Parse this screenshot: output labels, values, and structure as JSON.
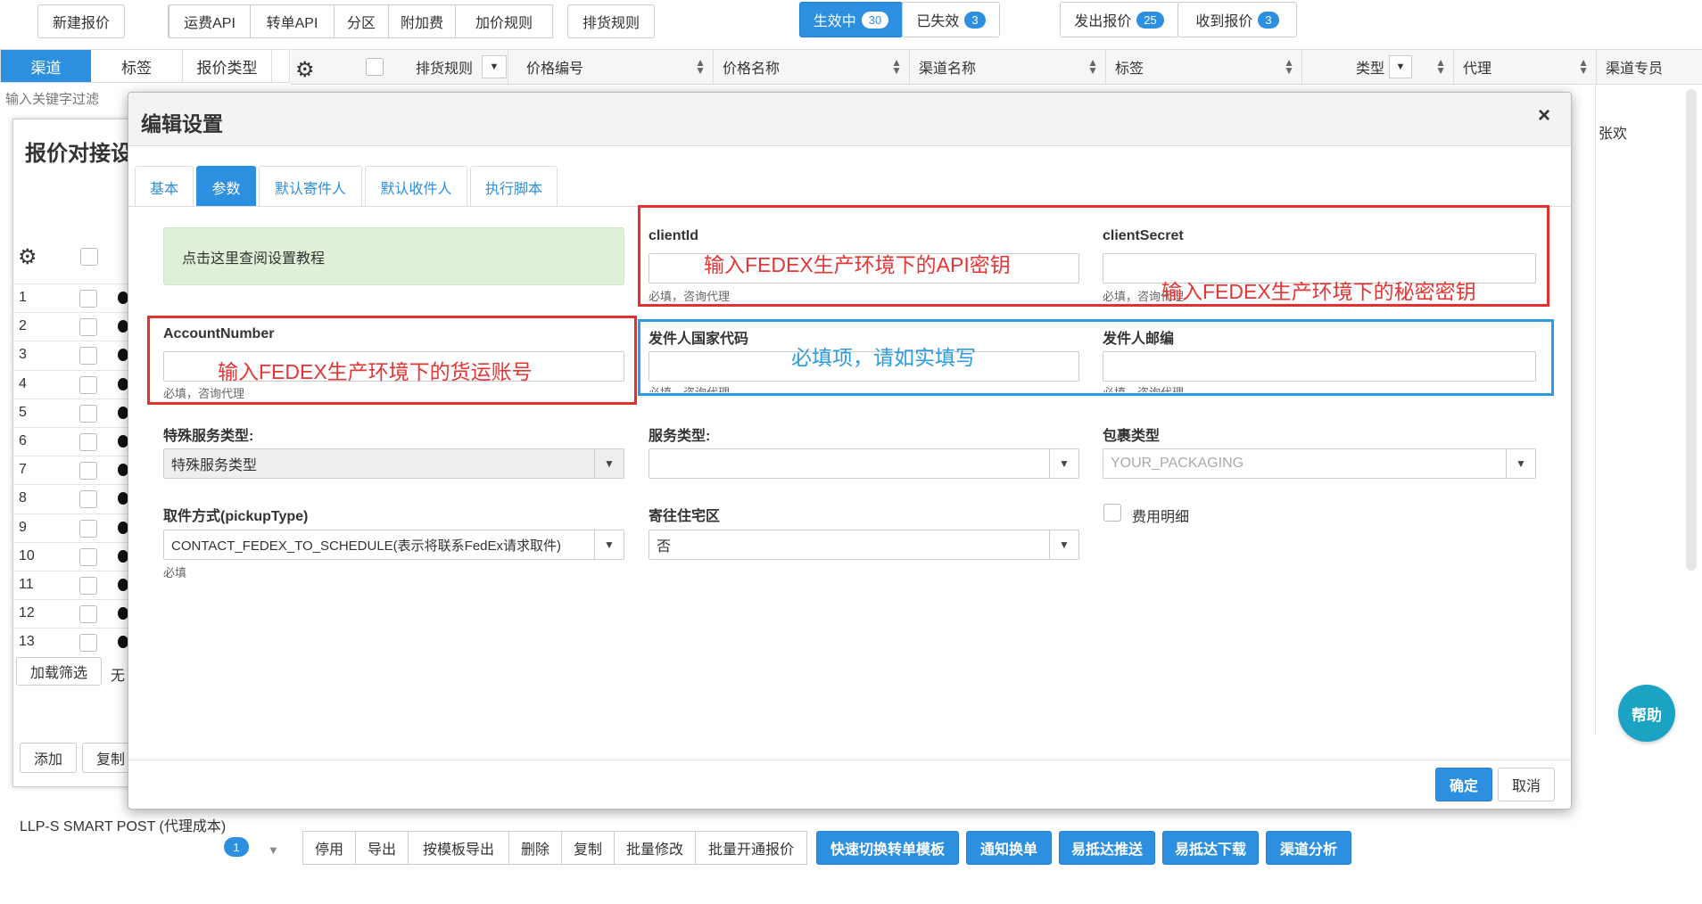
{
  "toolbar": {
    "new_quote": "新建报价",
    "group1": [
      "运费API",
      "转单API",
      "分区",
      "附加费",
      "加价规则"
    ],
    "shipping_rules": "排货规则",
    "status_active_label": "生效中",
    "status_active_count": "30",
    "status_expired_label": "已失效",
    "status_expired_count": "3",
    "sent_quotes_label": "发出报价",
    "sent_quotes_count": "25",
    "received_quotes_label": "收到报价",
    "received_quotes_count": "3"
  },
  "left_panel": {
    "tabs": [
      "渠道",
      "标签",
      "报价类型"
    ],
    "filter_placeholder": "输入关键字过滤",
    "channel_name": "LLP-S SMART POST (代理成本)",
    "channel_count": "1"
  },
  "table": {
    "headers": [
      "排货规则",
      "价格编号",
      "价格名称",
      "渠道名称",
      "标签",
      "类型",
      "代理",
      "渠道专员"
    ],
    "first_row_agent_rep": "张欢"
  },
  "bg_window": {
    "title": "报价对接设",
    "rows": [
      "1",
      "2",
      "3",
      "4",
      "5",
      "6",
      "7",
      "8",
      "9",
      "10",
      "11",
      "12",
      "13"
    ],
    "load_filter": "加载筛选",
    "none_label": "无",
    "add": "添加",
    "copy": "复制"
  },
  "bottom_bar": {
    "buttons": [
      "停用",
      "导出",
      "按模板导出",
      "删除",
      "复制",
      "批量修改",
      "批量开通报价"
    ],
    "primary_buttons": [
      "快速切换转单模板",
      "通知换单",
      "易抵达推送",
      "易抵达下载",
      "渠道分析"
    ]
  },
  "dialog": {
    "title": "编辑设置",
    "close": "×",
    "tabs": [
      "基本",
      "参数",
      "默认寄件人",
      "默认收件人",
      "执行脚本"
    ],
    "active_tab": "参数",
    "tutorial_link": "点击这里查阅设置教程",
    "fields": {
      "client_id_label": "clientId",
      "client_id_hint": "必填，咨询代理",
      "client_secret_label": "clientSecret",
      "client_secret_hint": "必填，咨询代理",
      "account_number_label": "AccountNumber",
      "account_number_hint": "必填，咨询代理",
      "sender_country_label": "发件人国家代码",
      "sender_country_hint": "必填，咨询代理",
      "sender_zip_label": "发件人邮编",
      "sender_zip_hint": "必填，咨询代理",
      "special_service_label": "特殊服务类型:",
      "special_service_value": "特殊服务类型",
      "service_type_label": "服务类型:",
      "service_type_value": "",
      "package_type_label": "包裹类型",
      "package_type_value": "YOUR_PACKAGING",
      "pickup_type_label": "取件方式(pickupType)",
      "pickup_type_value": "CONTACT_FEDEX_TO_SCHEDULE(表示将联系FedEx请求取件)",
      "pickup_type_hint": "必填",
      "residential_label": "寄往住宅区",
      "residential_value": "否",
      "fee_detail_label": "费用明细"
    },
    "annotations": {
      "api_key": "输入FEDEX生产环境下的API密钥",
      "secret_key": "输入FEDEX生产环境下的秘密密钥",
      "account": "输入FEDEX生产环境下的货运账号",
      "required": "必填项，请如实填写"
    },
    "ok": "确定",
    "cancel": "取消"
  },
  "help": "帮助",
  "colors": {
    "primary": "#2d8fe0",
    "annotation_red": "#e53535",
    "annotation_blue": "#2d9be0",
    "help": "#1aa3c2"
  }
}
